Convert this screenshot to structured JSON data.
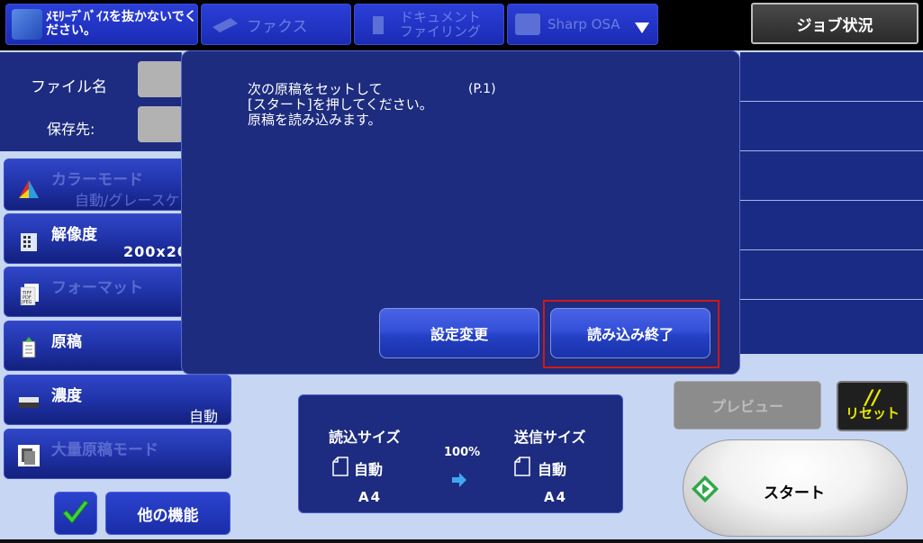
{
  "top_bar": {
    "memory_warning": "ﾒﾓﾘｰﾃﾞﾊﾞｲｽを抜かないでください。",
    "tab_fax": "ファクス",
    "tab_doc_filing": "ドキュメント\nファイリング",
    "tab_osa": "Sharp OSA",
    "job_status": "ジョブ状況"
  },
  "left_panel": {
    "file_name_label": "ファイル名",
    "save_to_label": "保存先:"
  },
  "settings": [
    {
      "name": "カラーモード",
      "value": "自動/グレースケ"
    },
    {
      "name": "解像度",
      "value": "200x20"
    },
    {
      "name": "フォーマット",
      "value": ""
    },
    {
      "name": "原稿",
      "value": ""
    },
    {
      "name": "濃度",
      "value": "自動"
    },
    {
      "name": "大量原稿モード",
      "value": ""
    }
  ],
  "modal": {
    "message_line1": "次の原稿をセットして",
    "message_line2": "[スタート]を押してください。",
    "message_line3": "原稿を読み込みます。",
    "page_indicator": "(P.1)",
    "change_settings_button": "設定変更",
    "finish_scan_button": "読み込み終了"
  },
  "size_panel": {
    "scan_size_label": "読込サイズ",
    "send_size_label": "送信サイズ",
    "ratio": "100%",
    "scan_mode": "自動",
    "send_mode": "自動",
    "scan_paper": "A4",
    "send_paper": "A4"
  },
  "buttons": {
    "preview": "プレビュー",
    "reset_slash": "//",
    "reset": "リセット",
    "start": "スタート",
    "other_functions": "他の機能"
  },
  "colors": {
    "highlight": "#d21818",
    "panel_blue": "#1d2c80",
    "button_blue": "#3350d8",
    "reset_yellow": "#e8e800"
  }
}
